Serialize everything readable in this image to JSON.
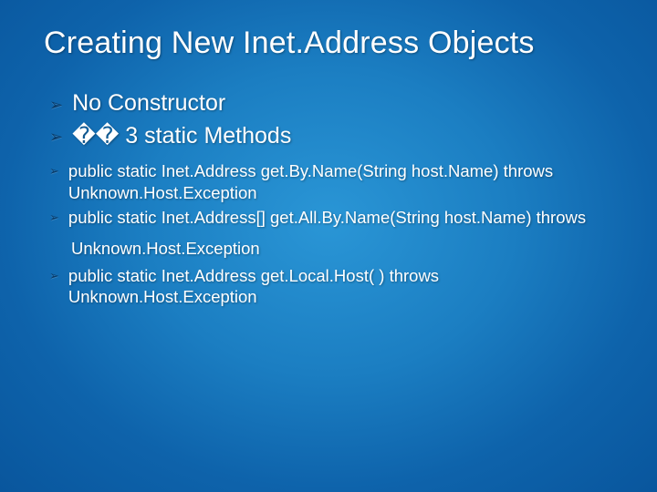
{
  "title": "Creating New Inet.Address Objects",
  "bullets": {
    "b1": "No Constructor",
    "b2": "�� 3 static Methods",
    "s1": "public static Inet.Address get.By.Name(String host.Name) throws Unknown.Host.Exception",
    "s2": "public static Inet.Address[] get.All.By.Name(String host.Name) throws",
    "s2b": "Unknown.Host.Exception",
    "s3": "public static Inet.Address get.Local.Host( ) throws Unknown.Host.Exception"
  }
}
